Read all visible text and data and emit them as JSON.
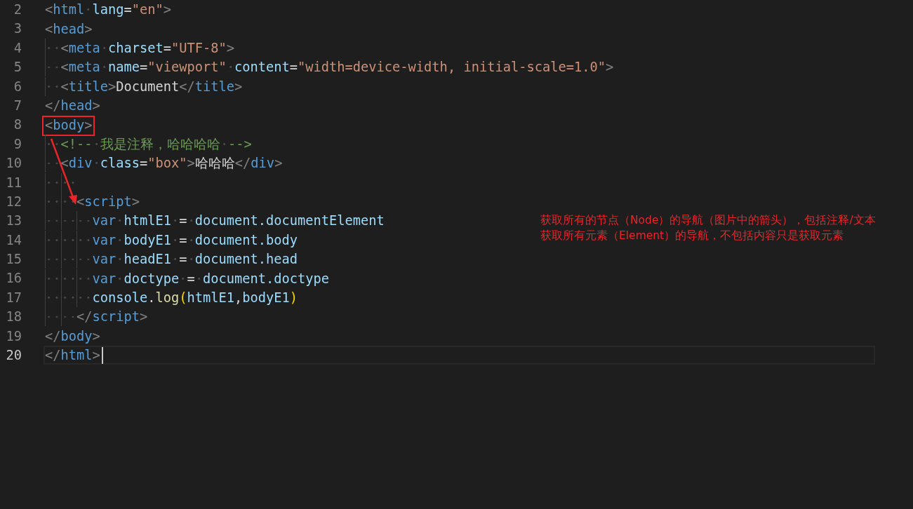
{
  "editor": {
    "lines": [
      {
        "number": "2",
        "current": false,
        "marked": false,
        "tokens": [
          {
            "kind": "punct",
            "text": "<"
          },
          {
            "kind": "tag",
            "text": "html"
          },
          {
            "kind": "space"
          },
          {
            "kind": "attr",
            "text": "lang"
          },
          {
            "kind": "op",
            "text": "="
          },
          {
            "kind": "str",
            "text": "\"en\""
          },
          {
            "kind": "punct",
            "text": ">"
          }
        ]
      },
      {
        "number": "3",
        "current": false,
        "marked": false,
        "tokens": [
          {
            "kind": "punct",
            "text": "<"
          },
          {
            "kind": "tag",
            "text": "head"
          },
          {
            "kind": "punct",
            "text": ">"
          }
        ]
      },
      {
        "number": "4",
        "current": false,
        "marked": false,
        "tokens": [
          {
            "kind": "indent"
          },
          {
            "kind": "punct",
            "text": "<"
          },
          {
            "kind": "tag",
            "text": "meta"
          },
          {
            "kind": "space"
          },
          {
            "kind": "attr",
            "text": "charset"
          },
          {
            "kind": "op",
            "text": "="
          },
          {
            "kind": "str",
            "text": "\"UTF-8\""
          },
          {
            "kind": "punct",
            "text": ">"
          }
        ]
      },
      {
        "number": "5",
        "current": false,
        "marked": false,
        "tokens": [
          {
            "kind": "indent"
          },
          {
            "kind": "punct",
            "text": "<"
          },
          {
            "kind": "tag",
            "text": "meta"
          },
          {
            "kind": "space"
          },
          {
            "kind": "attr",
            "text": "name"
          },
          {
            "kind": "op",
            "text": "="
          },
          {
            "kind": "str",
            "text": "\"viewport\""
          },
          {
            "kind": "space"
          },
          {
            "kind": "attr",
            "text": "content"
          },
          {
            "kind": "op",
            "text": "="
          },
          {
            "kind": "str",
            "text": "\"width=device-width, initial-scale=1.0\""
          },
          {
            "kind": "punct",
            "text": ">"
          }
        ]
      },
      {
        "number": "6",
        "current": false,
        "marked": false,
        "tokens": [
          {
            "kind": "indent"
          },
          {
            "kind": "punct",
            "text": "<"
          },
          {
            "kind": "tag",
            "text": "title"
          },
          {
            "kind": "punct",
            "text": ">"
          },
          {
            "kind": "text",
            "text": "Document"
          },
          {
            "kind": "punct",
            "text": "</"
          },
          {
            "kind": "tag",
            "text": "title"
          },
          {
            "kind": "punct",
            "text": ">"
          }
        ]
      },
      {
        "number": "7",
        "current": false,
        "marked": false,
        "tokens": [
          {
            "kind": "punct",
            "text": "</"
          },
          {
            "kind": "tag",
            "text": "head"
          },
          {
            "kind": "punct",
            "text": ">"
          }
        ]
      },
      {
        "number": "8",
        "current": false,
        "marked": true,
        "tokens": [
          {
            "kind": "punct",
            "text": "<"
          },
          {
            "kind": "tag",
            "text": "body"
          },
          {
            "kind": "punct",
            "text": ">"
          }
        ]
      },
      {
        "number": "9",
        "current": false,
        "marked": false,
        "tokens": [
          {
            "kind": "indent"
          },
          {
            "kind": "comment",
            "text": "<!--"
          },
          {
            "kind": "space"
          },
          {
            "kind": "comment",
            "text": "我是注释，哈哈哈哈"
          },
          {
            "kind": "space"
          },
          {
            "kind": "comment",
            "text": "-->"
          }
        ]
      },
      {
        "number": "10",
        "current": false,
        "marked": false,
        "tokens": [
          {
            "kind": "indent"
          },
          {
            "kind": "punct",
            "text": "<"
          },
          {
            "kind": "tag",
            "text": "div"
          },
          {
            "kind": "space"
          },
          {
            "kind": "attr",
            "text": "class"
          },
          {
            "kind": "op",
            "text": "="
          },
          {
            "kind": "str",
            "text": "\"box\""
          },
          {
            "kind": "punct",
            "text": ">"
          },
          {
            "kind": "text",
            "text": "哈哈哈"
          },
          {
            "kind": "punct",
            "text": "</"
          },
          {
            "kind": "tag",
            "text": "div"
          },
          {
            "kind": "punct",
            "text": ">"
          }
        ]
      },
      {
        "number": "11",
        "current": false,
        "marked": false,
        "tokens": [
          {
            "kind": "indent"
          },
          {
            "kind": "indent"
          }
        ]
      },
      {
        "number": "12",
        "current": false,
        "marked": false,
        "tokens": [
          {
            "kind": "indent"
          },
          {
            "kind": "indent"
          },
          {
            "kind": "punct",
            "text": "<"
          },
          {
            "kind": "tag",
            "text": "script"
          },
          {
            "kind": "punct",
            "text": ">"
          }
        ]
      },
      {
        "number": "13",
        "current": false,
        "marked": false,
        "tokens": [
          {
            "kind": "indent"
          },
          {
            "kind": "indent"
          },
          {
            "kind": "indent"
          },
          {
            "kind": "keyword",
            "text": "var"
          },
          {
            "kind": "space"
          },
          {
            "kind": "var",
            "text": "htmlE1"
          },
          {
            "kind": "space"
          },
          {
            "kind": "op",
            "text": "="
          },
          {
            "kind": "space"
          },
          {
            "kind": "var",
            "text": "document.documentElement"
          }
        ]
      },
      {
        "number": "14",
        "current": false,
        "marked": false,
        "tokens": [
          {
            "kind": "indent"
          },
          {
            "kind": "indent"
          },
          {
            "kind": "indent"
          },
          {
            "kind": "keyword",
            "text": "var"
          },
          {
            "kind": "space"
          },
          {
            "kind": "var",
            "text": "bodyE1"
          },
          {
            "kind": "space"
          },
          {
            "kind": "op",
            "text": "="
          },
          {
            "kind": "space"
          },
          {
            "kind": "var",
            "text": "document.body"
          }
        ]
      },
      {
        "number": "15",
        "current": false,
        "marked": false,
        "tokens": [
          {
            "kind": "indent"
          },
          {
            "kind": "indent"
          },
          {
            "kind": "indent"
          },
          {
            "kind": "keyword",
            "text": "var"
          },
          {
            "kind": "space"
          },
          {
            "kind": "var",
            "text": "headE1"
          },
          {
            "kind": "space"
          },
          {
            "kind": "op",
            "text": "="
          },
          {
            "kind": "space"
          },
          {
            "kind": "var",
            "text": "document.head"
          }
        ]
      },
      {
        "number": "16",
        "current": false,
        "marked": false,
        "tokens": [
          {
            "kind": "indent"
          },
          {
            "kind": "indent"
          },
          {
            "kind": "indent"
          },
          {
            "kind": "keyword",
            "text": "var"
          },
          {
            "kind": "space"
          },
          {
            "kind": "var",
            "text": "doctype"
          },
          {
            "kind": "space"
          },
          {
            "kind": "op",
            "text": "="
          },
          {
            "kind": "space"
          },
          {
            "kind": "var",
            "text": "document.doctype"
          }
        ]
      },
      {
        "number": "17",
        "current": false,
        "marked": false,
        "tokens": [
          {
            "kind": "indent"
          },
          {
            "kind": "indent"
          },
          {
            "kind": "indent"
          },
          {
            "kind": "var",
            "text": "console"
          },
          {
            "kind": "op",
            "text": "."
          },
          {
            "kind": "func",
            "text": "log"
          },
          {
            "kind": "bracket",
            "text": "("
          },
          {
            "kind": "var",
            "text": "htmlE1"
          },
          {
            "kind": "op",
            "text": ","
          },
          {
            "kind": "var",
            "text": "bodyE1"
          },
          {
            "kind": "bracket",
            "text": ")"
          }
        ]
      },
      {
        "number": "18",
        "current": false,
        "marked": false,
        "tokens": [
          {
            "kind": "indent"
          },
          {
            "kind": "indent"
          },
          {
            "kind": "punct",
            "text": "</"
          },
          {
            "kind": "tag",
            "text": "script"
          },
          {
            "kind": "punct",
            "text": ">"
          }
        ]
      },
      {
        "number": "19",
        "current": false,
        "marked": false,
        "tokens": [
          {
            "kind": "punct",
            "text": "</"
          },
          {
            "kind": "tag",
            "text": "body"
          },
          {
            "kind": "punct",
            "text": ">"
          }
        ]
      },
      {
        "number": "20",
        "current": true,
        "marked": false,
        "tokens": [
          {
            "kind": "punct",
            "text": "</"
          },
          {
            "kind": "tag",
            "text": "html"
          },
          {
            "kind": "punct",
            "text": ">"
          }
        ]
      }
    ]
  },
  "annotation": {
    "notes": [
      "获取所有的节点（Node）的导航（图片中的箭头），包括注释/文本",
      "获取所有元素（Element）的导航，不包括内容只是获取元素"
    ]
  }
}
